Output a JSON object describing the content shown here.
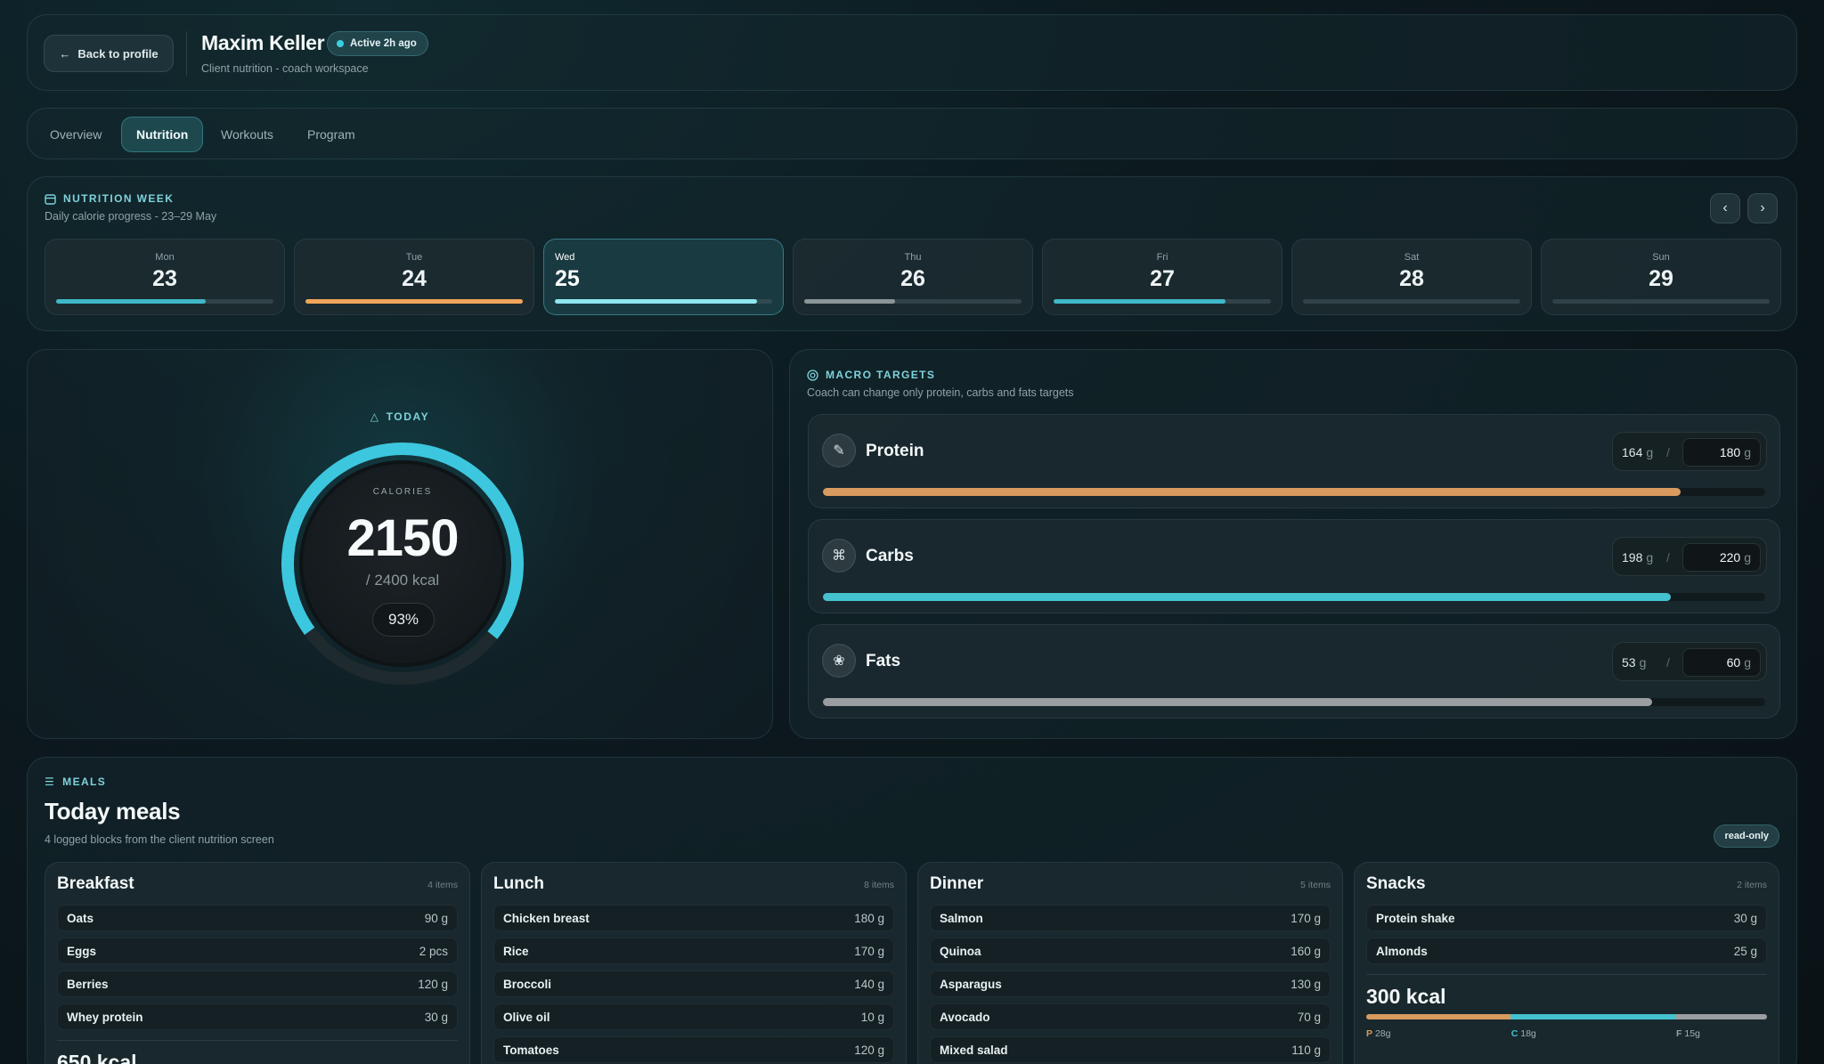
{
  "header": {
    "back_label": "Back to profile",
    "client_name": "Maxim Keller",
    "active_badge": "Active 2h ago",
    "subtitle": "Client nutrition - coach workspace"
  },
  "tabs": [
    {
      "label": "Overview",
      "active": false
    },
    {
      "label": "Nutrition",
      "active": true
    },
    {
      "label": "Workouts",
      "active": false
    },
    {
      "label": "Program",
      "active": false
    }
  ],
  "week": {
    "title": "NUTRITION WEEK",
    "subtitle": "Daily calorie progress - 23–29 May",
    "days": [
      {
        "name": "Mon",
        "num": "23",
        "progress": 0.69,
        "color": "#3fb8c7",
        "active": false
      },
      {
        "name": "Tue",
        "num": "24",
        "progress": 1.0,
        "color": "#f0a55a",
        "active": false
      },
      {
        "name": "Wed",
        "num": "25",
        "progress": 0.93,
        "color": "#8ee6f0",
        "active": true
      },
      {
        "name": "Thu",
        "num": "26",
        "progress": 0.42,
        "color": "#8a9598",
        "active": false
      },
      {
        "name": "Fri",
        "num": "27",
        "progress": 0.79,
        "color": "#3fb8c7",
        "active": false
      },
      {
        "name": "Sat",
        "num": "28",
        "progress": 0,
        "color": "#3fb8c7",
        "active": false
      },
      {
        "name": "Sun",
        "num": "29",
        "progress": 0,
        "color": "#3fb8c7",
        "active": false
      }
    ]
  },
  "today": {
    "label": "TODAY",
    "calories_label": "CALORIES",
    "calories": "2150",
    "target": "/ 2400 kcal",
    "percent_label": "93%",
    "progress": 0.93,
    "ring_color": "#3cc7de"
  },
  "macros": {
    "title": "MACRO TARGETS",
    "subtitle": "Coach can change only protein, carbs and fats targets",
    "items": [
      {
        "name": "Protein",
        "current": "164",
        "target": "180",
        "unit": "g",
        "progress": 0.91,
        "color": "#d99a5e",
        "icon": "protein-icon",
        "glyph": "✎"
      },
      {
        "name": "Carbs",
        "current": "198",
        "target": "220",
        "unit": "g",
        "progress": 0.9,
        "color": "#45c2cf",
        "icon": "carbs-icon",
        "glyph": "⌘"
      },
      {
        "name": "Fats",
        "current": "53",
        "target": "60",
        "unit": "g",
        "progress": 0.88,
        "color": "#9a9ea0",
        "icon": "fats-icon",
        "glyph": "❀"
      }
    ]
  },
  "meals": {
    "section_label": "MEALS",
    "title": "Today meals",
    "subtitle": "4 logged blocks from the client nutrition screen",
    "readonly": "read-only",
    "blocks": [
      {
        "name": "Breakfast",
        "count": "4 items",
        "items": [
          {
            "name": "Oats",
            "qty": "90 g"
          },
          {
            "name": "Eggs",
            "qty": "2 pcs"
          },
          {
            "name": "Berries",
            "qty": "120 g"
          },
          {
            "name": "Whey protein",
            "qty": "30 g"
          }
        ],
        "kcal": "650 kcal"
      },
      {
        "name": "Lunch",
        "count": "8 items",
        "items": [
          {
            "name": "Chicken breast",
            "qty": "180 g"
          },
          {
            "name": "Rice",
            "qty": "170 g"
          },
          {
            "name": "Broccoli",
            "qty": "140 g"
          },
          {
            "name": "Olive oil",
            "qty": "10 g"
          },
          {
            "name": "Tomatoes",
            "qty": "120 g"
          }
        ]
      },
      {
        "name": "Dinner",
        "count": "5 items",
        "items": [
          {
            "name": "Salmon",
            "qty": "170 g"
          },
          {
            "name": "Quinoa",
            "qty": "160 g"
          },
          {
            "name": "Asparagus",
            "qty": "130 g"
          },
          {
            "name": "Avocado",
            "qty": "70 g"
          },
          {
            "name": "Mixed salad",
            "qty": "110 g"
          }
        ]
      },
      {
        "name": "Snacks",
        "count": "2 items",
        "items": [
          {
            "name": "Protein shake",
            "qty": "30 g"
          },
          {
            "name": "Almonds",
            "qty": "25 g"
          }
        ],
        "kcal": "300 kcal",
        "split": [
          {
            "key": "P",
            "value": "28g",
            "share": 0.36,
            "color": "#d99a5e"
          },
          {
            "key": "C",
            "value": "18g",
            "share": 0.41,
            "color": "#45c2cf"
          },
          {
            "key": "F",
            "value": "15g",
            "share": 0.23,
            "color": "#9a9ea0"
          }
        ]
      }
    ]
  }
}
